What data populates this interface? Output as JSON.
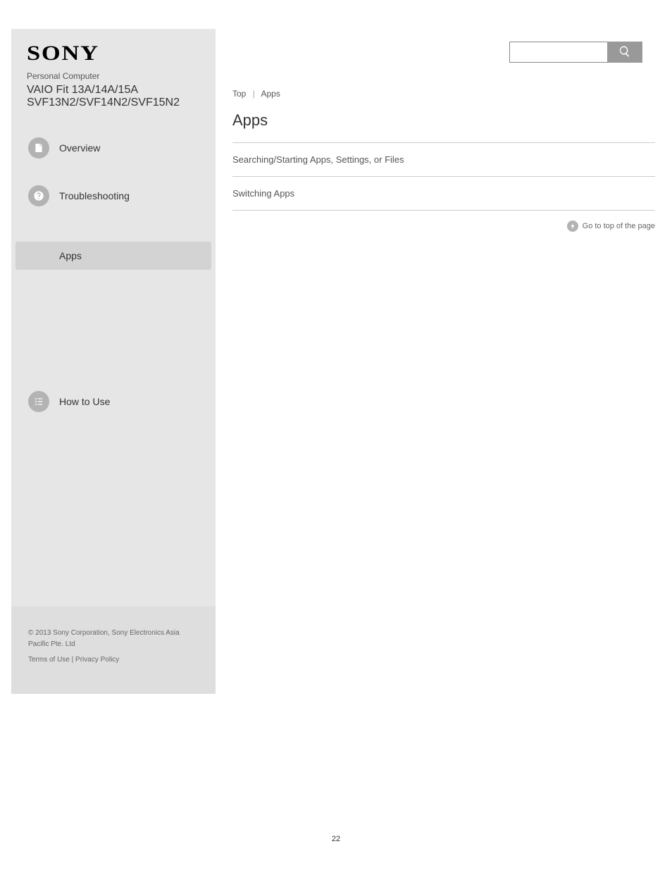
{
  "sidebar": {
    "logo": "SONY",
    "product_name": "Personal Computer",
    "model": "VAIO Fit 13A/14A/15A SVF13N2/SVF14N2/SVF15N2",
    "overview": "Overview",
    "troubleshooting": "Troubleshooting",
    "active_category": "Apps",
    "how_to_use": "How to Use",
    "legal1": "© 2013 Sony Corporation, Sony Electronics Asia Pacific Pte. Ltd",
    "legal2": "Terms of Use | Privacy Policy"
  },
  "search": {
    "placeholder": ""
  },
  "breadcrumb": {
    "top": "Top",
    "page": "Apps"
  },
  "main": {
    "title": "Apps",
    "link1": "Searching/Starting Apps, Settings, or Files",
    "link2": "Switching Apps",
    "goto_top": "Go to top of the page"
  },
  "page_number": "22"
}
